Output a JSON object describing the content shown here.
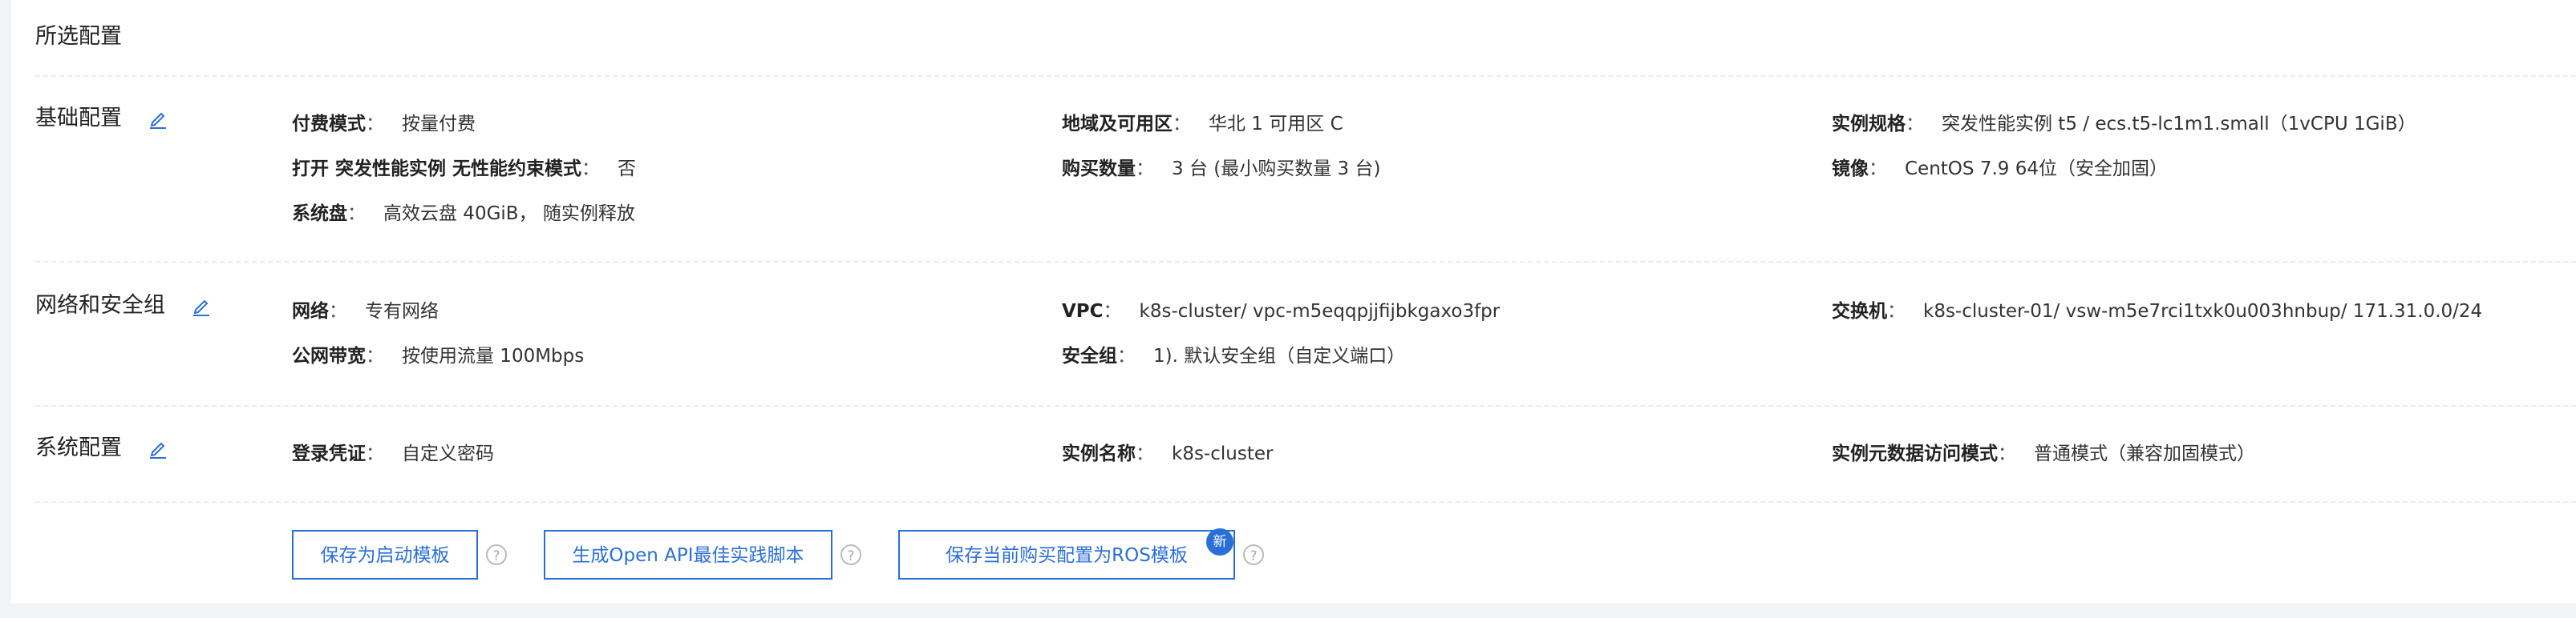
{
  "title": "所选配置",
  "sections": {
    "basic": {
      "label": "基础配置",
      "billing_key": "付费模式",
      "billing_val": "按量付费",
      "burst_key": "打开 突发性能实例 无性能约束模式",
      "burst_val": "否",
      "disk_key": "系统盘",
      "disk_val": "高效云盘 40GiB， 随实例释放",
      "region_key": "地域及可用区",
      "region_val": "华北 1 可用区 C",
      "count_key": "购买数量",
      "count_val": "3 台 (最小购买数量 3 台)",
      "spec_key": "实例规格",
      "spec_val": "突发性能实例 t5 / ecs.t5-lc1m1.small（1vCPU 1GiB）",
      "image_key": "镜像",
      "image_val": "CentOS 7.9 64位（安全加固）"
    },
    "network": {
      "label": "网络和安全组",
      "net_key": "网络",
      "net_val": "专有网络",
      "bw_key": "公网带宽",
      "bw_val": "按使用流量 100Mbps",
      "vpc_key": "VPC",
      "vpc_val": "k8s-cluster/ vpc-m5eqqpjjfijbkgaxo3fpr",
      "sg_key": "安全组",
      "sg_val": "1). 默认安全组（自定义端口）",
      "vsw_key": "交换机",
      "vsw_val": "k8s-cluster-01/ vsw-m5e7rci1txk0u003hnbup/ 171.31.0.0/24"
    },
    "system": {
      "label": "系统配置",
      "login_key": "登录凭证",
      "login_val": "自定义密码",
      "name_key": "实例名称",
      "name_val": "k8s-cluster",
      "meta_key": "实例元数据访问模式",
      "meta_val": "普通模式（兼容加固模式）"
    }
  },
  "buttons": {
    "save_template": "保存为启动模板",
    "gen_openapi": "生成Open API最佳实践脚本",
    "save_ros": "保存当前购买配置为ROS模板",
    "new_badge": "新",
    "help_glyph": "?"
  },
  "colon": "：",
  "colors": {
    "accent": "#2b6fd6",
    "divider": "#ececec",
    "background": "#f2f3f5"
  },
  "icons": {
    "edit": "edit-icon",
    "help": "question-circle-icon"
  }
}
